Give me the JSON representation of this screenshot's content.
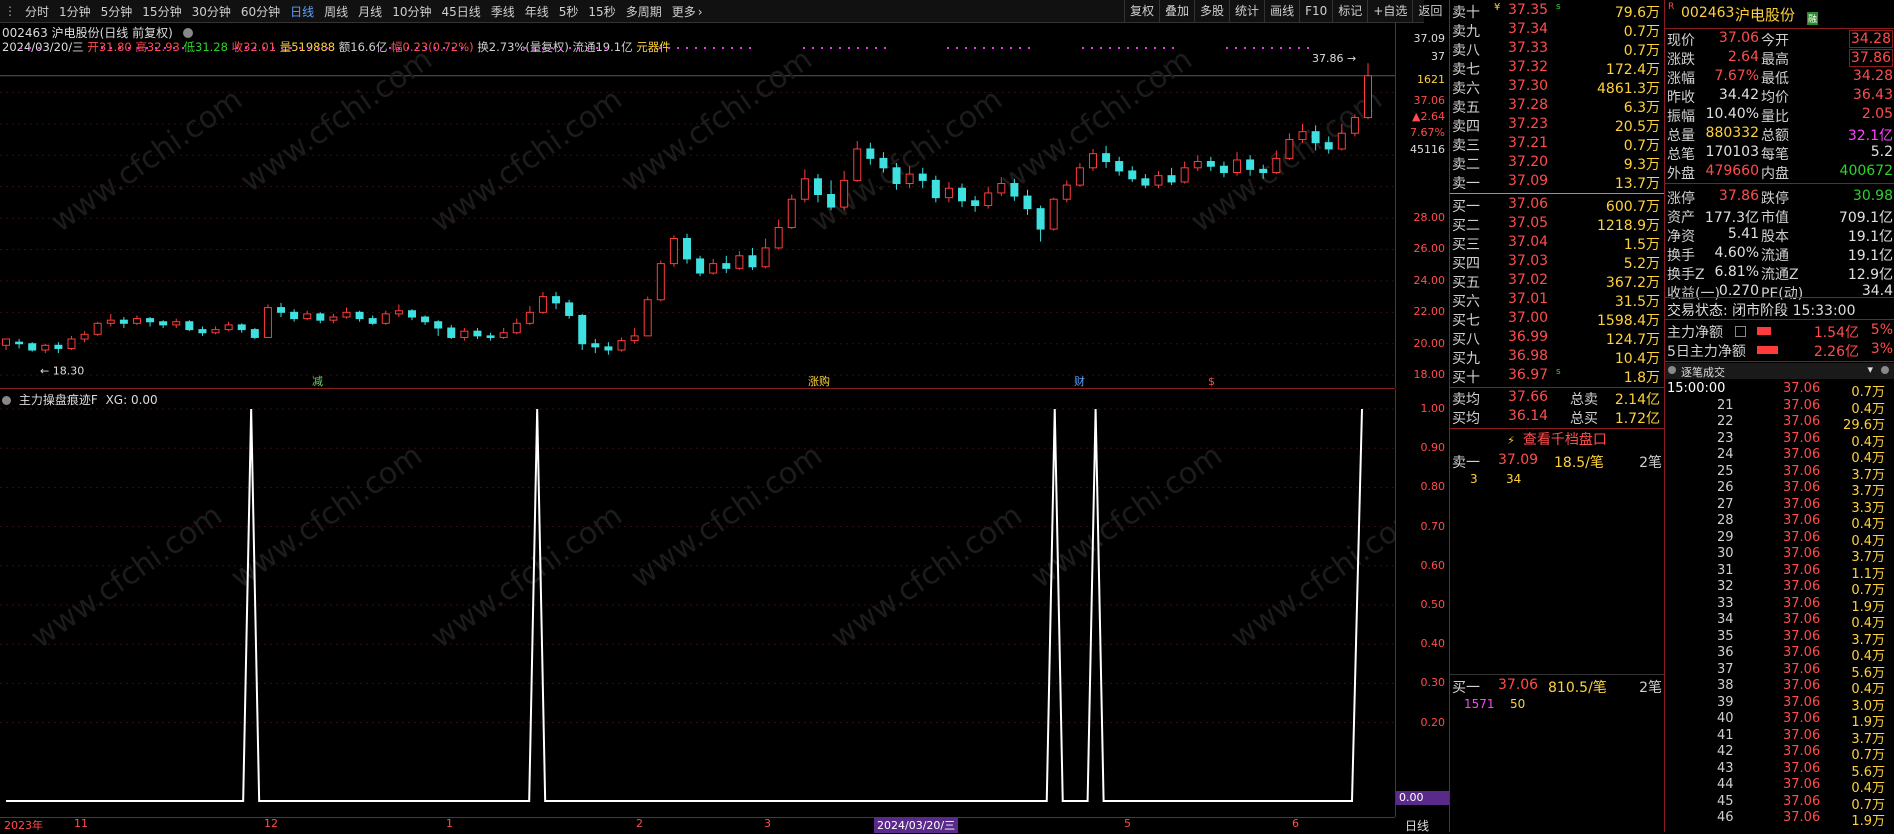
{
  "toolbar": {
    "periods": [
      "分时",
      "1分钟",
      "5分钟",
      "15分钟",
      "30分钟",
      "60分钟",
      "日线",
      "周线",
      "月线",
      "10分钟",
      "45日线",
      "季线",
      "年线",
      "5秒",
      "15秒",
      "多周期",
      "更多"
    ],
    "active": "日线",
    "right_buttons": [
      "复权",
      "叠加",
      "多股",
      "统计",
      "画线",
      "F10",
      "标记",
      "+自选",
      "返回"
    ]
  },
  "kline_header": {
    "title": "002463 沪电股份(日线 前复权)",
    "date": "2024/03/20/三",
    "open_label": "开",
    "open": "31.80",
    "high_label": "高",
    "high": "32.93",
    "low_label": "低",
    "low": "31.28",
    "close_label": "收",
    "close": "32.01",
    "vol_label": "量",
    "vol": "519888",
    "amount_label": "额",
    "amount": "16.6亿",
    "chg_label": "幅",
    "chg": "0.23(0.72%)",
    "turnover": "换2.73%(量复权)",
    "float": "流通19.1亿",
    "concept": "元器件",
    "low_marker": "18.30",
    "high_marker": "37.86"
  },
  "k_axis": {
    "labels": [
      "37.09",
      "37",
      "1621",
      "37.06",
      "▲2.64",
      "7.67%",
      "45116",
      "28.00",
      "26.00",
      "24.00",
      "22.00",
      "20.00",
      "18.00"
    ]
  },
  "event_marks": [
    "减",
    "涨购",
    "财",
    "$"
  ],
  "indicator": {
    "title": "主力操盘痕迹F",
    "xg": "XG: 0.00",
    "axis": [
      "1.00",
      "0.90",
      "0.80",
      "0.70",
      "0.60",
      "0.50",
      "0.40",
      "0.30",
      "0.20"
    ],
    "current": "0.00"
  },
  "x_axis": {
    "labels": [
      "2023年",
      "11",
      "12",
      "1",
      "2",
      "3",
      "2024/03/20/三",
      "5",
      "6"
    ],
    "period_label": "日线"
  },
  "orderbook": {
    "asks": [
      {
        "label": "卖十",
        "price": "37.35",
        "vol": "79.6万",
        "flag": "¥",
        "sub": "s"
      },
      {
        "label": "卖九",
        "price": "37.34",
        "vol": "0.7万"
      },
      {
        "label": "卖八",
        "price": "37.33",
        "vol": "0.7万"
      },
      {
        "label": "卖七",
        "price": "37.32",
        "vol": "172.4万"
      },
      {
        "label": "卖六",
        "price": "37.30",
        "vol": "4861.3万"
      },
      {
        "label": "卖五",
        "price": "37.28",
        "vol": "6.3万"
      },
      {
        "label": "卖四",
        "price": "37.23",
        "vol": "20.5万"
      },
      {
        "label": "卖三",
        "price": "37.21",
        "vol": "0.7万"
      },
      {
        "label": "卖二",
        "price": "37.20",
        "vol": "9.3万"
      },
      {
        "label": "卖一",
        "price": "37.09",
        "vol": "13.7万"
      }
    ],
    "bids": [
      {
        "label": "买一",
        "price": "37.06",
        "vol": "600.7万"
      },
      {
        "label": "买二",
        "price": "37.05",
        "vol": "1218.9万"
      },
      {
        "label": "买三",
        "price": "37.04",
        "vol": "1.5万"
      },
      {
        "label": "买四",
        "price": "37.03",
        "vol": "5.2万"
      },
      {
        "label": "买五",
        "price": "37.02",
        "vol": "367.2万"
      },
      {
        "label": "买六",
        "price": "37.01",
        "vol": "31.5万"
      },
      {
        "label": "买七",
        "price": "37.00",
        "vol": "1598.4万"
      },
      {
        "label": "买八",
        "price": "36.99",
        "vol": "124.7万"
      },
      {
        "label": "买九",
        "price": "36.98",
        "vol": "10.4万"
      },
      {
        "label": "买十",
        "price": "36.97",
        "vol": "1.8万",
        "sub": "s"
      }
    ],
    "avg_ask": {
      "label": "卖均",
      "price": "37.66",
      "tlabel": "总卖",
      "total": "2.14亿"
    },
    "avg_bid": {
      "label": "买均",
      "price": "36.14",
      "tlabel": "总买",
      "total": "1.72亿"
    },
    "qiandang_button": "查看千档盘口",
    "ask1_box": {
      "label": "卖一",
      "price": "37.09",
      "lots": "18.5/笔",
      "count": "2笔",
      "q1": "3",
      "q2": "34"
    },
    "bid1_box": {
      "label": "买一",
      "price": "37.06",
      "lots": "810.5/笔",
      "count": "2笔",
      "q1": "1571",
      "q2": "50"
    }
  },
  "info": {
    "badge": "R",
    "code": "002463",
    "name": "沪电股份",
    "tag": "融",
    "rows": [
      {
        "l1": "现价",
        "v1": "37.06",
        "c1": "red",
        "l2": "今开",
        "v2": "34.28",
        "c2": "red"
      },
      {
        "l1": "涨跌",
        "v1": "2.64",
        "c1": "red",
        "l2": "最高",
        "v2": "37.86",
        "c2": "red"
      },
      {
        "l1": "涨幅",
        "v1": "7.67%",
        "c1": "red",
        "l2": "最低",
        "v2": "34.28",
        "c2": "red"
      },
      {
        "l1": "昨收",
        "v1": "34.42",
        "c1": "white",
        "l2": "均价",
        "v2": "36.43",
        "c2": "red"
      },
      {
        "l1": "振幅",
        "v1": "10.40%",
        "c1": "white",
        "l2": "量比",
        "v2": "2.05",
        "c2": "red"
      },
      {
        "l1": "总量",
        "v1": "880332",
        "c1": "yellow",
        "l2": "总额",
        "v2": "32.1亿",
        "c2": "magenta"
      },
      {
        "l1": "总笔",
        "v1": "170103",
        "c1": "white",
        "l2": "每笔",
        "v2": "5.2",
        "c2": "white"
      },
      {
        "l1": "外盘",
        "v1": "479660",
        "c1": "red",
        "l2": "内盘",
        "v2": "400672",
        "c2": "green"
      },
      {
        "l1": "涨停",
        "v1": "37.86",
        "c1": "red",
        "l2": "跌停",
        "v2": "30.98",
        "c2": "green"
      },
      {
        "l1": "资产",
        "v1": "177.3亿",
        "c1": "white",
        "l2": "市值",
        "v2": "709.1亿",
        "c2": "white"
      },
      {
        "l1": "净资",
        "v1": "5.41",
        "c1": "white",
        "l2": "股本",
        "v2": "19.1亿",
        "c2": "white"
      },
      {
        "l1": "换手",
        "v1": "4.60%",
        "c1": "white",
        "l2": "流通",
        "v2": "19.1亿",
        "c2": "white"
      },
      {
        "l1": "换手Z",
        "v1": "6.81%",
        "c1": "white",
        "l2": "流通Z",
        "v2": "12.9亿",
        "c2": "white"
      },
      {
        "l1": "收益(一)",
        "v1": "0.270",
        "c1": "white",
        "l2": "PE(动)",
        "v2": "34.4",
        "c2": "white"
      }
    ],
    "trade_status": "交易状态: 闭市阶段 15:33:00",
    "main_flow": {
      "label": "主力净额",
      "value": "1.54亿",
      "pct": "5%",
      "bar": 0.55
    },
    "main_flow5": {
      "label": "5日主力净额",
      "value": "2.26亿",
      "pct": "3%",
      "bar": 0.8
    },
    "ticks_title": "逐笔成交",
    "ticks_time": "15:00:00",
    "ticks": [
      {
        "t": "",
        "p": "37.06",
        "v": "0.7万"
      },
      {
        "t": "21",
        "p": "37.06",
        "v": "0.4万"
      },
      {
        "t": "22",
        "p": "37.06",
        "v": "29.6万"
      },
      {
        "t": "23",
        "p": "37.06",
        "v": "0.4万"
      },
      {
        "t": "24",
        "p": "37.06",
        "v": "0.4万"
      },
      {
        "t": "25",
        "p": "37.06",
        "v": "3.7万"
      },
      {
        "t": "26",
        "p": "37.06",
        "v": "3.7万"
      },
      {
        "t": "27",
        "p": "37.06",
        "v": "3.3万"
      },
      {
        "t": "28",
        "p": "37.06",
        "v": "0.4万"
      },
      {
        "t": "29",
        "p": "37.06",
        "v": "0.4万"
      },
      {
        "t": "30",
        "p": "37.06",
        "v": "3.7万"
      },
      {
        "t": "31",
        "p": "37.06",
        "v": "1.1万"
      },
      {
        "t": "32",
        "p": "37.06",
        "v": "0.7万"
      },
      {
        "t": "33",
        "p": "37.06",
        "v": "1.9万"
      },
      {
        "t": "34",
        "p": "37.06",
        "v": "0.4万"
      },
      {
        "t": "35",
        "p": "37.06",
        "v": "3.7万"
      },
      {
        "t": "36",
        "p": "37.06",
        "v": "0.4万"
      },
      {
        "t": "37",
        "p": "37.06",
        "v": "5.6万"
      },
      {
        "t": "38",
        "p": "37.06",
        "v": "0.4万"
      },
      {
        "t": "39",
        "p": "37.06",
        "v": "3.0万"
      },
      {
        "t": "40",
        "p": "37.06",
        "v": "1.9万"
      },
      {
        "t": "41",
        "p": "37.06",
        "v": "3.7万"
      },
      {
        "t": "42",
        "p": "37.06",
        "v": "0.7万"
      },
      {
        "t": "43",
        "p": "37.06",
        "v": "5.6万"
      },
      {
        "t": "44",
        "p": "37.06",
        "v": "0.4万"
      },
      {
        "t": "45",
        "p": "37.06",
        "v": "0.7万"
      },
      {
        "t": "46",
        "p": "37.06",
        "v": "1.9万"
      }
    ]
  },
  "watermark": "www.cfchi.com",
  "chart_data": {
    "type": "candlestick",
    "ylim": [
      17.5,
      38
    ],
    "indicator_spikes_at": [
      0.18,
      0.39,
      0.77,
      0.8
    ],
    "candles": [
      [
        19.9,
        20.3,
        19.6,
        20.1
      ],
      [
        20.1,
        20.0,
        19.7,
        20.3
      ],
      [
        20.0,
        19.6,
        19.5,
        20.1
      ],
      [
        19.6,
        19.9,
        19.4,
        20.0
      ],
      [
        19.9,
        19.7,
        19.4,
        20.1
      ],
      [
        19.7,
        20.3,
        19.6,
        20.5
      ],
      [
        20.3,
        20.6,
        20.1,
        20.8
      ],
      [
        20.6,
        21.3,
        20.5,
        21.4
      ],
      [
        21.3,
        21.5,
        21.1,
        21.9
      ],
      [
        21.5,
        21.3,
        21.0,
        21.7
      ],
      [
        21.3,
        21.6,
        21.2,
        21.8
      ],
      [
        21.6,
        21.4,
        21.1,
        21.7
      ],
      [
        21.4,
        21.2,
        21.0,
        21.5
      ],
      [
        21.2,
        21.4,
        21.0,
        21.6
      ],
      [
        21.4,
        20.9,
        20.8,
        21.5
      ],
      [
        20.9,
        20.7,
        20.5,
        21.1
      ],
      [
        20.7,
        20.9,
        20.6,
        21.1
      ],
      [
        20.9,
        21.2,
        20.8,
        21.4
      ],
      [
        21.2,
        20.9,
        20.7,
        21.3
      ],
      [
        20.9,
        20.4,
        20.3,
        21.0
      ],
      [
        20.4,
        22.3,
        20.4,
        22.5
      ],
      [
        22.3,
        22.0,
        21.7,
        22.6
      ],
      [
        22.0,
        21.6,
        21.4,
        22.2
      ],
      [
        21.6,
        21.9,
        21.5,
        22.1
      ],
      [
        21.9,
        21.5,
        21.3,
        22.0
      ],
      [
        21.5,
        21.7,
        21.3,
        21.9
      ],
      [
        21.7,
        22.0,
        21.6,
        22.3
      ],
      [
        22.0,
        21.6,
        21.4,
        22.1
      ],
      [
        21.6,
        21.3,
        21.2,
        21.8
      ],
      [
        21.3,
        21.9,
        21.2,
        22.1
      ],
      [
        21.9,
        22.1,
        21.7,
        22.5
      ],
      [
        22.1,
        21.7,
        21.5,
        22.2
      ],
      [
        21.7,
        21.4,
        21.2,
        21.8
      ],
      [
        21.4,
        21.0,
        20.5,
        21.5
      ],
      [
        21.0,
        20.4,
        20.3,
        21.2
      ],
      [
        20.4,
        20.8,
        20.2,
        21.0
      ],
      [
        20.8,
        20.5,
        20.3,
        21.0
      ],
      [
        20.5,
        20.4,
        20.2,
        20.7
      ],
      [
        20.4,
        20.7,
        20.3,
        21.0
      ],
      [
        20.7,
        21.3,
        20.6,
        21.6
      ],
      [
        21.3,
        22.0,
        21.2,
        22.4
      ],
      [
        22.0,
        23.0,
        21.9,
        23.3
      ],
      [
        23.0,
        22.6,
        22.2,
        23.3
      ],
      [
        22.6,
        21.8,
        21.6,
        22.8
      ],
      [
        21.8,
        20.0,
        19.6,
        21.9
      ],
      [
        20.0,
        19.8,
        19.4,
        20.3
      ],
      [
        19.8,
        19.6,
        19.3,
        20.1
      ],
      [
        19.6,
        20.2,
        19.5,
        20.4
      ],
      [
        20.2,
        20.5,
        20.0,
        21.0
      ],
      [
        20.5,
        22.8,
        20.5,
        23.0
      ],
      [
        22.8,
        25.1,
        22.7,
        25.3
      ],
      [
        25.1,
        26.7,
        24.9,
        26.9
      ],
      [
        26.7,
        25.4,
        25.1,
        27.0
      ],
      [
        25.4,
        24.5,
        24.3,
        25.6
      ],
      [
        24.5,
        25.1,
        24.4,
        25.4
      ],
      [
        25.1,
        24.8,
        24.5,
        25.6
      ],
      [
        24.8,
        25.6,
        24.7,
        25.9
      ],
      [
        25.6,
        24.9,
        24.7,
        26.1
      ],
      [
        24.9,
        26.1,
        24.8,
        26.7
      ],
      [
        26.1,
        27.4,
        26.0,
        27.9
      ],
      [
        27.4,
        29.2,
        27.3,
        29.5
      ],
      [
        29.2,
        30.5,
        29.0,
        31.1
      ],
      [
        30.5,
        29.5,
        29.0,
        30.8
      ],
      [
        29.5,
        28.7,
        28.5,
        30.4
      ],
      [
        28.7,
        30.4,
        28.5,
        31.0
      ],
      [
        30.4,
        32.4,
        30.3,
        32.9
      ],
      [
        32.4,
        31.8,
        31.4,
        32.8
      ],
      [
        31.8,
        31.2,
        30.9,
        32.2
      ],
      [
        31.2,
        30.2,
        29.8,
        31.5
      ],
      [
        30.2,
        30.8,
        29.9,
        31.3
      ],
      [
        30.8,
        30.4,
        29.9,
        31.2
      ],
      [
        30.4,
        29.3,
        29.0,
        30.7
      ],
      [
        29.3,
        29.9,
        29.0,
        30.3
      ],
      [
        29.9,
        29.1,
        28.7,
        30.2
      ],
      [
        29.1,
        28.8,
        28.4,
        29.4
      ],
      [
        28.8,
        29.6,
        28.6,
        30.0
      ],
      [
        29.6,
        30.2,
        29.4,
        30.6
      ],
      [
        30.2,
        29.4,
        29.1,
        30.5
      ],
      [
        29.4,
        28.6,
        28.2,
        29.8
      ],
      [
        28.6,
        27.3,
        26.5,
        28.8
      ],
      [
        27.3,
        29.2,
        27.2,
        29.3
      ],
      [
        29.2,
        30.1,
        29.0,
        30.4
      ],
      [
        30.1,
        31.2,
        30.0,
        31.5
      ],
      [
        31.2,
        32.1,
        31.0,
        32.4
      ],
      [
        32.1,
        31.6,
        31.2,
        32.6
      ],
      [
        31.6,
        31.0,
        30.7,
        31.9
      ],
      [
        31.0,
        30.5,
        30.3,
        31.3
      ],
      [
        30.5,
        30.1,
        29.9,
        30.8
      ],
      [
        30.1,
        30.7,
        29.9,
        31.0
      ],
      [
        30.7,
        30.3,
        30.1,
        31.2
      ],
      [
        30.3,
        31.2,
        30.2,
        31.6
      ],
      [
        31.2,
        31.6,
        31.0,
        32.0
      ],
      [
        31.6,
        31.3,
        31.0,
        31.9
      ],
      [
        31.3,
        30.9,
        30.6,
        31.6
      ],
      [
        30.9,
        31.7,
        30.7,
        32.2
      ],
      [
        31.7,
        31.1,
        30.7,
        32.0
      ],
      [
        31.1,
        30.9,
        30.5,
        31.4
      ],
      [
        30.9,
        31.8,
        30.8,
        32.3
      ],
      [
        31.8,
        33.0,
        31.7,
        33.4
      ],
      [
        33.0,
        33.5,
        32.8,
        34.0
      ],
      [
        33.5,
        32.8,
        32.3,
        33.9
      ],
      [
        32.8,
        32.4,
        32.1,
        33.2
      ],
      [
        32.4,
        33.4,
        32.3,
        34.0
      ],
      [
        33.4,
        34.4,
        33.2,
        34.6
      ],
      [
        34.4,
        37.06,
        34.28,
        37.86
      ]
    ]
  }
}
